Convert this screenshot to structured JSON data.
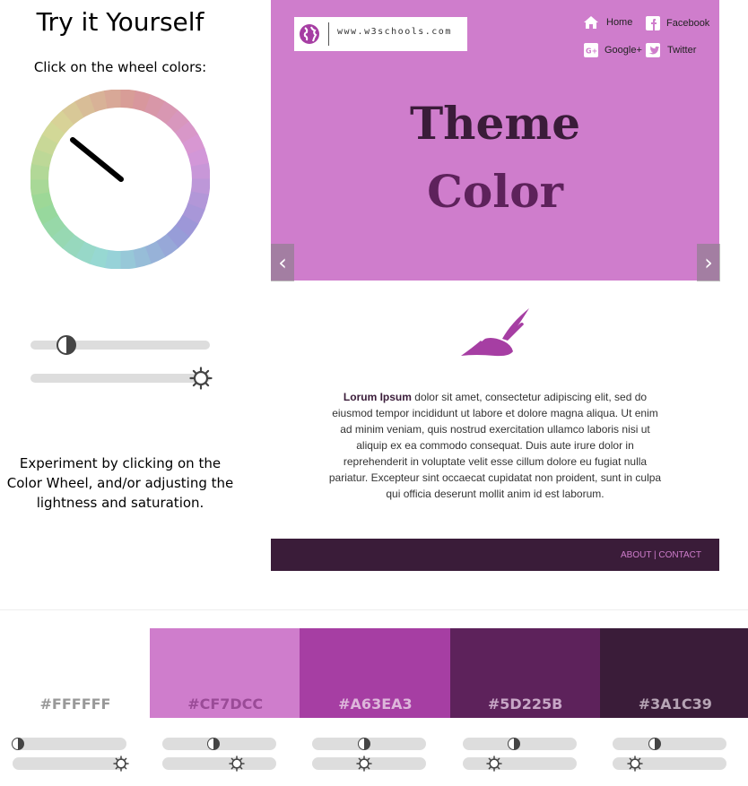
{
  "left": {
    "title": "Try it Yourself",
    "wheel_instruction": "Click on the wheel colors:",
    "experiment_text": "Experiment by clicking on the Color Wheel, and/or adjusting the lightness and saturation."
  },
  "sliders": {
    "lightness_level": 0.2,
    "saturation_level": 0.95
  },
  "preview": {
    "logo_text": "www.w3schools.com",
    "nav": [
      {
        "label": "Home",
        "icon": "home-icon"
      },
      {
        "label": "Facebook",
        "icon": "facebook-icon"
      },
      {
        "label": "Google+",
        "icon": "google-plus-icon"
      },
      {
        "label": "Twitter",
        "icon": "twitter-icon"
      }
    ],
    "theme_line1": "Theme",
    "theme_line2": "Color",
    "prev_label": "‹",
    "next_label": "›",
    "lorem_bold": "Lorum Ipsum",
    "lorem_rest": " dolor sit amet, consectetur adipiscing elit, sed do eiusmod tempor incididunt ut labore et dolore magna aliqua. Ut enim ad minim veniam, quis nostrud exercitation ullamco laboris nisi ut aliquip ex ea commodo consequat. Duis aute irure dolor in reprehenderit in voluptate velit esse cillum dolore eu fugiat nulla pariatur. Excepteur sint occaecat cupidatat non proident, sunt in culpa qui officia deserunt mollit anim id est laborum.",
    "footer_links": "ABOUT | CONTACT"
  },
  "colors": {
    "header_bg": "#CF7DCC",
    "theme_line1": "#3A1C39",
    "theme_line2": "#5D225B",
    "accent": "#A63EA3",
    "footer_bg": "#3A1C39",
    "footer_text": "#CF7DCC"
  },
  "swatches": [
    {
      "hex": "#FFFFFF",
      "bg": "#FFFFFF",
      "text_color": "#999999",
      "lightness": 0.05,
      "saturation": 0.95
    },
    {
      "hex": "#CF7DCC",
      "bg": "#CF7DCC",
      "text_color": "#9A4B97",
      "lightness": 0.45,
      "saturation": 0.65
    },
    {
      "hex": "#A63EA3",
      "bg": "#A63EA3",
      "text_color": "#DDB6DB",
      "lightness": 0.45,
      "saturation": 0.45
    },
    {
      "hex": "#5D225B",
      "bg": "#5D225B",
      "text_color": "#C7A6C6",
      "lightness": 0.45,
      "saturation": 0.28
    },
    {
      "hex": "#3A1C39",
      "bg": "#3A1C39",
      "text_color": "#B6A4B5",
      "lightness": 0.37,
      "saturation": 0.2
    }
  ]
}
